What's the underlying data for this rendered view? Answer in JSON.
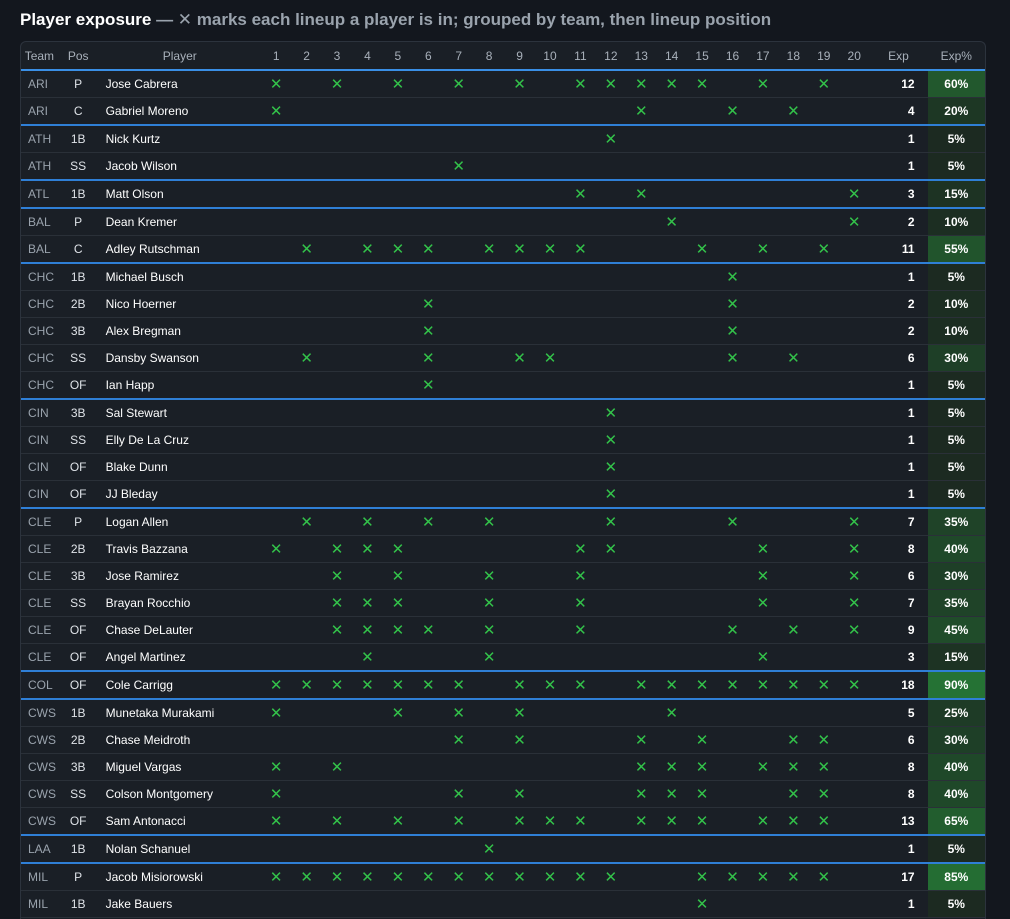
{
  "title": {
    "bold": "Player exposure",
    "subtitle": " — ✕ marks each lineup a player is in; grouped by team, then lineup position"
  },
  "columns": {
    "team": "Team",
    "pos": "Pos",
    "player": "Player",
    "lineups": [
      "1",
      "2",
      "3",
      "4",
      "5",
      "6",
      "7",
      "8",
      "9",
      "10",
      "11",
      "12",
      "13",
      "14",
      "15",
      "16",
      "17",
      "18",
      "19",
      "20"
    ],
    "exp": "Exp",
    "exp_pct": "Exp%"
  },
  "mark_symbol": "✕",
  "colors": {
    "mark": "#33c24a",
    "group_divider": "#2f7fd6",
    "heat_base": "#1b2620",
    "heat_max": "#267a36"
  },
  "rows": [
    {
      "team": "ARI",
      "pos": "P",
      "player": "Jose Cabrera",
      "lineups": [
        1,
        3,
        5,
        7,
        9,
        11,
        12,
        13,
        14,
        15,
        17,
        19
      ],
      "exp": "12",
      "pct": "60%",
      "pct_value": 0.6
    },
    {
      "team": "ARI",
      "pos": "C",
      "player": "Gabriel Moreno",
      "lineups": [
        1,
        13,
        16,
        18
      ],
      "exp": "4",
      "pct": "20%",
      "pct_value": 0.2
    },
    {
      "team": "ATH",
      "pos": "1B",
      "player": "Nick Kurtz",
      "lineups": [
        12
      ],
      "exp": "1",
      "pct": "5%",
      "pct_value": 0.05
    },
    {
      "team": "ATH",
      "pos": "SS",
      "player": "Jacob Wilson",
      "lineups": [
        7
      ],
      "exp": "1",
      "pct": "5%",
      "pct_value": 0.05
    },
    {
      "team": "ATL",
      "pos": "1B",
      "player": "Matt Olson",
      "lineups": [
        11,
        13,
        20
      ],
      "exp": "3",
      "pct": "15%",
      "pct_value": 0.15
    },
    {
      "team": "BAL",
      "pos": "P",
      "player": "Dean Kremer",
      "lineups": [
        14,
        20
      ],
      "exp": "2",
      "pct": "10%",
      "pct_value": 0.1
    },
    {
      "team": "BAL",
      "pos": "C",
      "player": "Adley Rutschman",
      "lineups": [
        2,
        4,
        5,
        6,
        8,
        9,
        10,
        11,
        15,
        17,
        19
      ],
      "exp": "11",
      "pct": "55%",
      "pct_value": 0.55
    },
    {
      "team": "CHC",
      "pos": "1B",
      "player": "Michael Busch",
      "lineups": [
        16
      ],
      "exp": "1",
      "pct": "5%",
      "pct_value": 0.05
    },
    {
      "team": "CHC",
      "pos": "2B",
      "player": "Nico Hoerner",
      "lineups": [
        6,
        16
      ],
      "exp": "2",
      "pct": "10%",
      "pct_value": 0.1
    },
    {
      "team": "CHC",
      "pos": "3B",
      "player": "Alex Bregman",
      "lineups": [
        6,
        16
      ],
      "exp": "2",
      "pct": "10%",
      "pct_value": 0.1
    },
    {
      "team": "CHC",
      "pos": "SS",
      "player": "Dansby Swanson",
      "lineups": [
        2,
        6,
        9,
        10,
        16,
        18
      ],
      "exp": "6",
      "pct": "30%",
      "pct_value": 0.3
    },
    {
      "team": "CHC",
      "pos": "OF",
      "player": "Ian Happ",
      "lineups": [
        6
      ],
      "exp": "1",
      "pct": "5%",
      "pct_value": 0.05
    },
    {
      "team": "CIN",
      "pos": "3B",
      "player": "Sal Stewart",
      "lineups": [
        12
      ],
      "exp": "1",
      "pct": "5%",
      "pct_value": 0.05
    },
    {
      "team": "CIN",
      "pos": "SS",
      "player": "Elly De La Cruz",
      "lineups": [
        12
      ],
      "exp": "1",
      "pct": "5%",
      "pct_value": 0.05
    },
    {
      "team": "CIN",
      "pos": "OF",
      "player": "Blake Dunn",
      "lineups": [
        12
      ],
      "exp": "1",
      "pct": "5%",
      "pct_value": 0.05
    },
    {
      "team": "CIN",
      "pos": "OF",
      "player": "JJ Bleday",
      "lineups": [
        12
      ],
      "exp": "1",
      "pct": "5%",
      "pct_value": 0.05
    },
    {
      "team": "CLE",
      "pos": "P",
      "player": "Logan Allen",
      "lineups": [
        2,
        4,
        6,
        8,
        12,
        16,
        20
      ],
      "exp": "7",
      "pct": "35%",
      "pct_value": 0.35
    },
    {
      "team": "CLE",
      "pos": "2B",
      "player": "Travis Bazzana",
      "lineups": [
        1,
        3,
        4,
        5,
        11,
        12,
        17,
        20
      ],
      "exp": "8",
      "pct": "40%",
      "pct_value": 0.4
    },
    {
      "team": "CLE",
      "pos": "3B",
      "player": "Jose Ramirez",
      "lineups": [
        3,
        5,
        8,
        11,
        17,
        20
      ],
      "exp": "6",
      "pct": "30%",
      "pct_value": 0.3
    },
    {
      "team": "CLE",
      "pos": "SS",
      "player": "Brayan Rocchio",
      "lineups": [
        3,
        4,
        5,
        8,
        11,
        17,
        20
      ],
      "exp": "7",
      "pct": "35%",
      "pct_value": 0.35
    },
    {
      "team": "CLE",
      "pos": "OF",
      "player": "Chase DeLauter",
      "lineups": [
        3,
        4,
        5,
        6,
        8,
        11,
        16,
        18,
        20
      ],
      "exp": "9",
      "pct": "45%",
      "pct_value": 0.45
    },
    {
      "team": "CLE",
      "pos": "OF",
      "player": "Angel Martinez",
      "lineups": [
        4,
        8,
        17
      ],
      "exp": "3",
      "pct": "15%",
      "pct_value": 0.15
    },
    {
      "team": "COL",
      "pos": "OF",
      "player": "Cole Carrigg",
      "lineups": [
        1,
        2,
        3,
        4,
        5,
        6,
        7,
        9,
        10,
        11,
        13,
        14,
        15,
        16,
        17,
        18,
        19,
        20
      ],
      "exp": "18",
      "pct": "90%",
      "pct_value": 0.9
    },
    {
      "team": "CWS",
      "pos": "1B",
      "player": "Munetaka Murakami",
      "lineups": [
        1,
        5,
        7,
        9,
        14
      ],
      "exp": "5",
      "pct": "25%",
      "pct_value": 0.25
    },
    {
      "team": "CWS",
      "pos": "2B",
      "player": "Chase Meidroth",
      "lineups": [
        7,
        9,
        13,
        15,
        18,
        19
      ],
      "exp": "6",
      "pct": "30%",
      "pct_value": 0.3
    },
    {
      "team": "CWS",
      "pos": "3B",
      "player": "Miguel Vargas",
      "lineups": [
        1,
        3,
        13,
        14,
        15,
        17,
        18,
        19
      ],
      "exp": "8",
      "pct": "40%",
      "pct_value": 0.4
    },
    {
      "team": "CWS",
      "pos": "SS",
      "player": "Colson Montgomery",
      "lineups": [
        1,
        7,
        9,
        13,
        14,
        15,
        18,
        19
      ],
      "exp": "8",
      "pct": "40%",
      "pct_value": 0.4
    },
    {
      "team": "CWS",
      "pos": "OF",
      "player": "Sam Antonacci",
      "lineups": [
        1,
        3,
        5,
        7,
        9,
        10,
        11,
        13,
        14,
        15,
        17,
        18,
        19
      ],
      "exp": "13",
      "pct": "65%",
      "pct_value": 0.65
    },
    {
      "team": "LAA",
      "pos": "1B",
      "player": "Nolan Schanuel",
      "lineups": [
        8
      ],
      "exp": "1",
      "pct": "5%",
      "pct_value": 0.05
    },
    {
      "team": "MIL",
      "pos": "P",
      "player": "Jacob Misiorowski",
      "lineups": [
        1,
        2,
        3,
        4,
        5,
        6,
        7,
        8,
        9,
        10,
        11,
        12,
        15,
        16,
        17,
        18,
        19
      ],
      "exp": "17",
      "pct": "85%",
      "pct_value": 0.85
    },
    {
      "team": "MIL",
      "pos": "1B",
      "player": "Jake Bauers",
      "lineups": [
        15
      ],
      "exp": "1",
      "pct": "5%",
      "pct_value": 0.05
    }
  ]
}
